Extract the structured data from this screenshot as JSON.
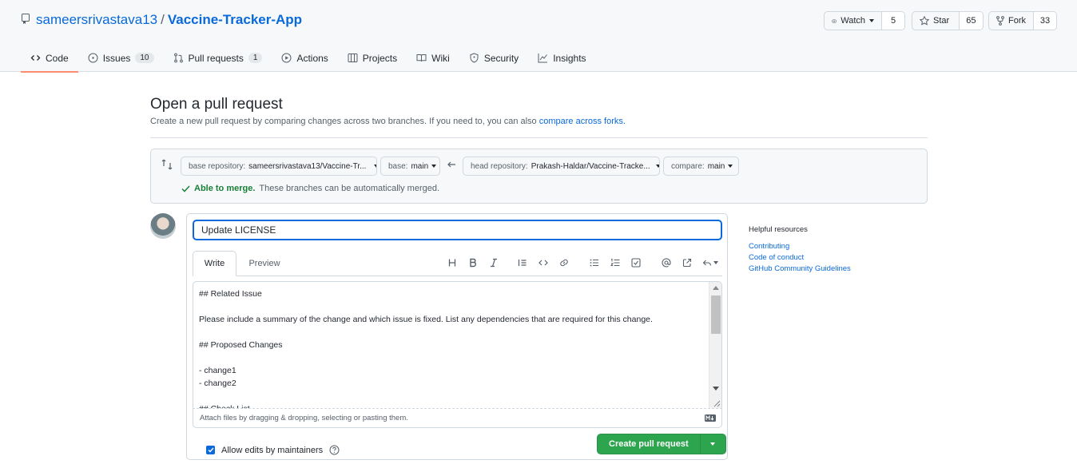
{
  "repo": {
    "owner": "sameersrivastava13",
    "separator": "/",
    "name": "Vaccine-Tracker-App"
  },
  "actions": {
    "watch": {
      "label": "Watch",
      "count": "5"
    },
    "star": {
      "label": "Star",
      "count": "65"
    },
    "fork": {
      "label": "Fork",
      "count": "33"
    }
  },
  "tabs": [
    {
      "label": "Code",
      "icon": "code-icon"
    },
    {
      "label": "Issues",
      "icon": "issue-icon",
      "count": "10"
    },
    {
      "label": "Pull requests",
      "icon": "pull-request-icon",
      "count": "1"
    },
    {
      "label": "Actions",
      "icon": "play-icon"
    },
    {
      "label": "Projects",
      "icon": "table-icon"
    },
    {
      "label": "Wiki",
      "icon": "book-icon"
    },
    {
      "label": "Security",
      "icon": "shield-icon"
    },
    {
      "label": "Insights",
      "icon": "graph-icon"
    }
  ],
  "page": {
    "title": "Open a pull request",
    "subtitle": "Create a new pull request by comparing changes across two branches. If you need to, you can also",
    "subtitle_link": "compare across forks."
  },
  "compare": {
    "base_repo_label": "base repository:",
    "base_repo_value": "sameersrivastava13/Vaccine-Tr...",
    "base_label": "base:",
    "base_value": "main",
    "head_repo_label": "head repository:",
    "head_repo_value": "Prakash-Haldar/Vaccine-Tracke...",
    "compare_label": "compare:",
    "compare_value": "main",
    "merge_status": "Able to merge.",
    "merge_message": "These branches can be automatically merged."
  },
  "form": {
    "title_value": "Update LICENSE",
    "write_tab": "Write",
    "preview_tab": "Preview",
    "toolbar": [
      "heading-icon",
      "bold-icon",
      "italic-icon",
      "quote-icon",
      "code-icon",
      "link-icon",
      "unordered-list-icon",
      "ordered-list-icon",
      "task-list-icon",
      "mention-icon",
      "reference-icon",
      "reply-icon"
    ],
    "body_lines": [
      "## Related Issue",
      "",
      "Please include a summary of the change and which issue is fixed. List any dependencies that are required for this change.",
      "",
      "## Proposed Changes",
      "",
      "- change1",
      "- change2",
      "",
      "## Check List"
    ],
    "attach_text": "Attach files by dragging & dropping, selecting or pasting them.",
    "allow_edits_label": "Allow edits by maintainers",
    "allow_edits_checked": true,
    "submit_label": "Create pull request"
  },
  "sidebar": {
    "heading": "Helpful resources",
    "links": [
      "Contributing",
      "Code of conduct",
      "GitHub Community Guidelines"
    ]
  },
  "colors": {
    "link": "#0969da",
    "success": "#2da44e",
    "active_tab_underline": "#fd8c73"
  }
}
